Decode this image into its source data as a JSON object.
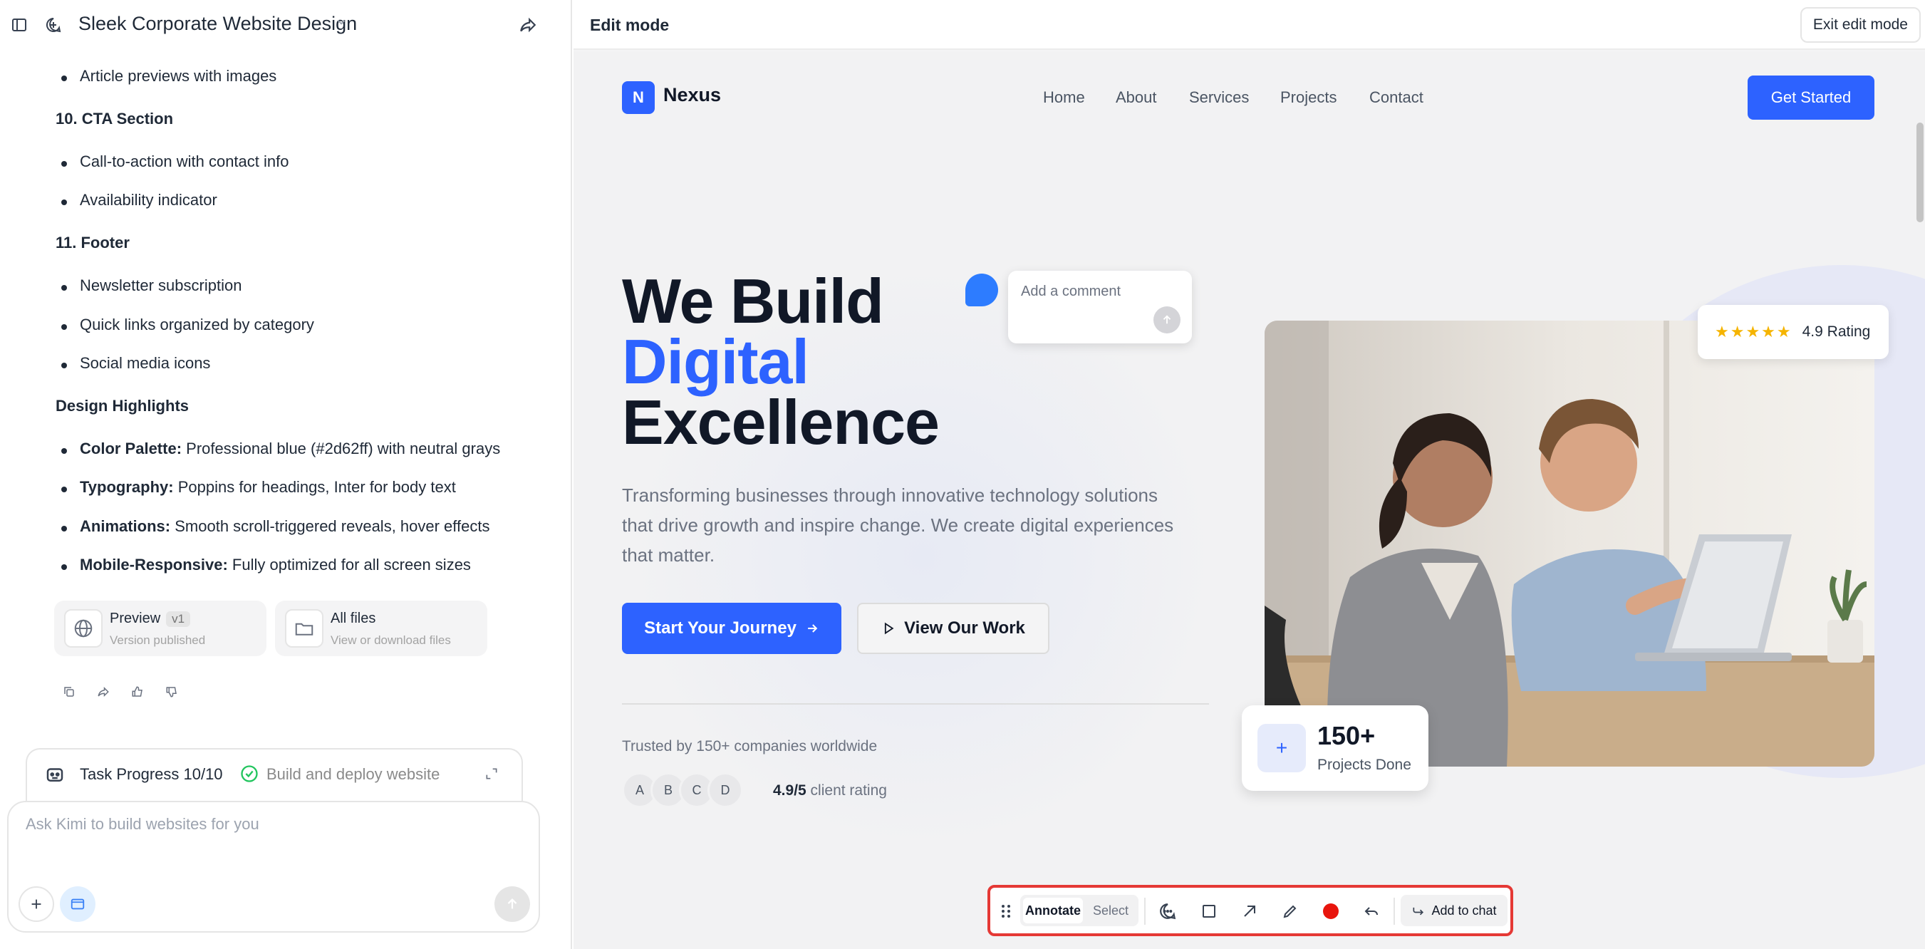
{
  "left": {
    "chat_title": "Sleek Corporate Website Design",
    "icons": {
      "sidebar": "sidebar-toggle-icon",
      "new_chat": "new-chat-icon",
      "share": "share-icon"
    },
    "content": {
      "b_article": "Article previews with images",
      "s_cta": "10. CTA Section",
      "b_cta1": "Call-to-action with contact info",
      "b_cta2": "Availability indicator",
      "s_footer": "11. Footer",
      "b_f1": "Newsletter subscription",
      "b_f2": "Quick links organized by category",
      "b_f3": "Social media icons",
      "s_design": "Design Highlights",
      "h1_label": "Color Palette:",
      "h1_text": " Professional blue (#2d62ff) with neutral grays",
      "h2_label": "Typography:",
      "h2_text": " Poppins for headings, Inter for body text",
      "h3_label": "Animations:",
      "h3_text": " Smooth scroll-triggered reveals, hover effects",
      "h4_label": "Mobile-Responsive:",
      "h4_text": " Fully optimized for all screen sizes"
    },
    "cards": {
      "preview_title": "Preview",
      "preview_version": "v1",
      "preview_sub": "Version published",
      "files_title": "All files",
      "files_sub": "View or download files"
    },
    "task": {
      "label": "Task Progress 10/10",
      "status": "Build and deploy website"
    },
    "composer": {
      "placeholder": "Ask Kimi to build websites for you"
    }
  },
  "right": {
    "mode_label": "Edit mode",
    "exit_label": "Exit edit mode",
    "site": {
      "logo_letter": "N",
      "logo_name": "Nexus",
      "nav": [
        "Home",
        "About",
        "Services",
        "Projects",
        "Contact"
      ],
      "cta": "Get Started",
      "hero_line1": "We Build",
      "hero_line2": "Digital",
      "hero_line3": "Excellence",
      "hero_p1": "Transforming businesses through innovative technology solutions",
      "hero_p2": "that drive growth and inspire change. We create digital experiences",
      "hero_p3": "that matter.",
      "btn_start": "Start Your Journey",
      "btn_work": "View Our Work",
      "trusted": "Trusted by 150+ companies worldwide",
      "avatars": [
        "A",
        "B",
        "C",
        "D"
      ],
      "client_rating_value": "4.9/5",
      "client_rating_label": " client rating",
      "stars": "★★★★★",
      "rating_value": "4.9 Rating",
      "projects_count": "150+",
      "projects_label": "Projects Done"
    },
    "comment": {
      "placeholder": "Add a comment"
    },
    "toolbar": {
      "annotate": "Annotate",
      "select": "Select",
      "add_to_chat": "Add to chat",
      "record_color": "#e53935"
    }
  },
  "colors": {
    "brand": "#2d62ff",
    "highlight_border": "#e53935"
  }
}
